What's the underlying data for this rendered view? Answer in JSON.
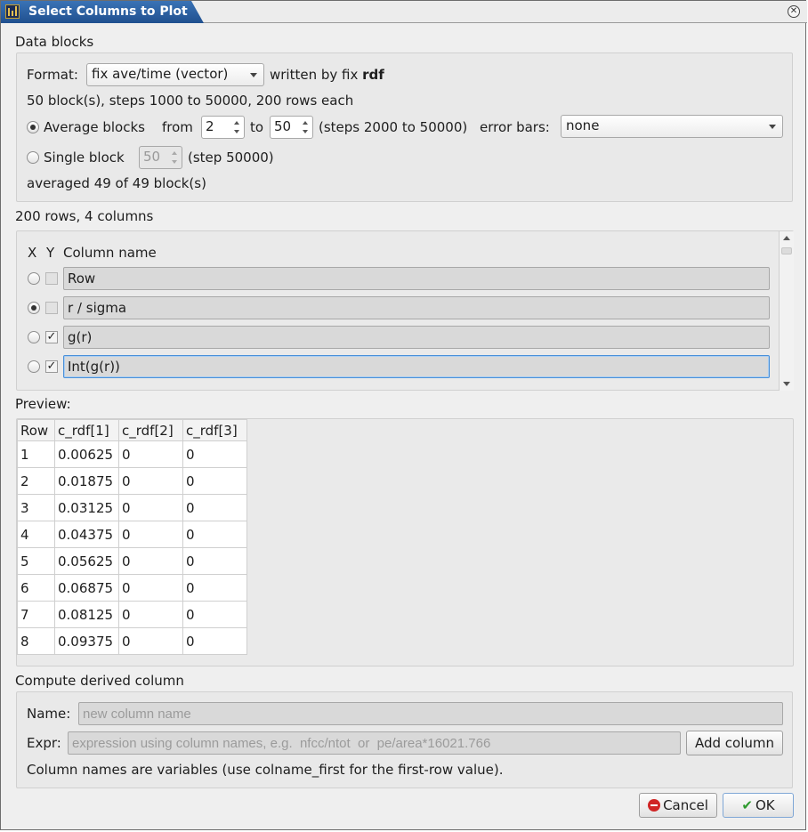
{
  "window": {
    "title": "Select Columns to Plot"
  },
  "data_blocks": {
    "heading": "Data blocks",
    "format_label": "Format:",
    "format_value": "fix ave/time (vector)",
    "written_by_prefix": "written by fix",
    "written_by_name": "rdf",
    "summary": "50 block(s), steps 1000 to 50000, 200 rows each",
    "average_label": "Average blocks",
    "from_label": "from",
    "from_value": "2",
    "to_label": "to",
    "to_value": "50",
    "steps_range": "(steps 2000 to 50000)",
    "error_bars_label": "error bars:",
    "error_bars_value": "none",
    "single_label": "Single block",
    "single_value": "50",
    "single_step": "(step 50000)",
    "averaged_status": "averaged 49 of 49 block(s)"
  },
  "columns": {
    "summary": "200 rows, 4 columns",
    "header_x": "X",
    "header_y": "Y",
    "header_name": "Column name",
    "rows": [
      {
        "name": "Row",
        "x_selected": false,
        "y_checked": false
      },
      {
        "name": "r / sigma",
        "x_selected": true,
        "y_checked": false
      },
      {
        "name": "g(r)",
        "x_selected": false,
        "y_checked": true
      },
      {
        "name": "Int(g(r))",
        "x_selected": false,
        "y_checked": true
      }
    ]
  },
  "preview": {
    "heading": "Preview:",
    "headers": [
      "Row",
      "c_rdf[1]",
      "c_rdf[2]",
      "c_rdf[3]"
    ],
    "rows": [
      [
        "1",
        "0.00625",
        "0",
        "0"
      ],
      [
        "2",
        "0.01875",
        "0",
        "0"
      ],
      [
        "3",
        "0.03125",
        "0",
        "0"
      ],
      [
        "4",
        "0.04375",
        "0",
        "0"
      ],
      [
        "5",
        "0.05625",
        "0",
        "0"
      ],
      [
        "6",
        "0.06875",
        "0",
        "0"
      ],
      [
        "7",
        "0.08125",
        "0",
        "0"
      ],
      [
        "8",
        "0.09375",
        "0",
        "0"
      ]
    ]
  },
  "derived": {
    "heading": "Compute derived column",
    "name_label": "Name:",
    "name_placeholder": "new column name",
    "expr_label": "Expr:",
    "expr_placeholder": "expression using column names, e.g.  nfcc/ntot  or  pe/area*16021.766",
    "add_button": "Add column",
    "hint": "Column names are variables (use colname_first for the first-row value)."
  },
  "buttons": {
    "cancel": "Cancel",
    "ok": "OK"
  }
}
